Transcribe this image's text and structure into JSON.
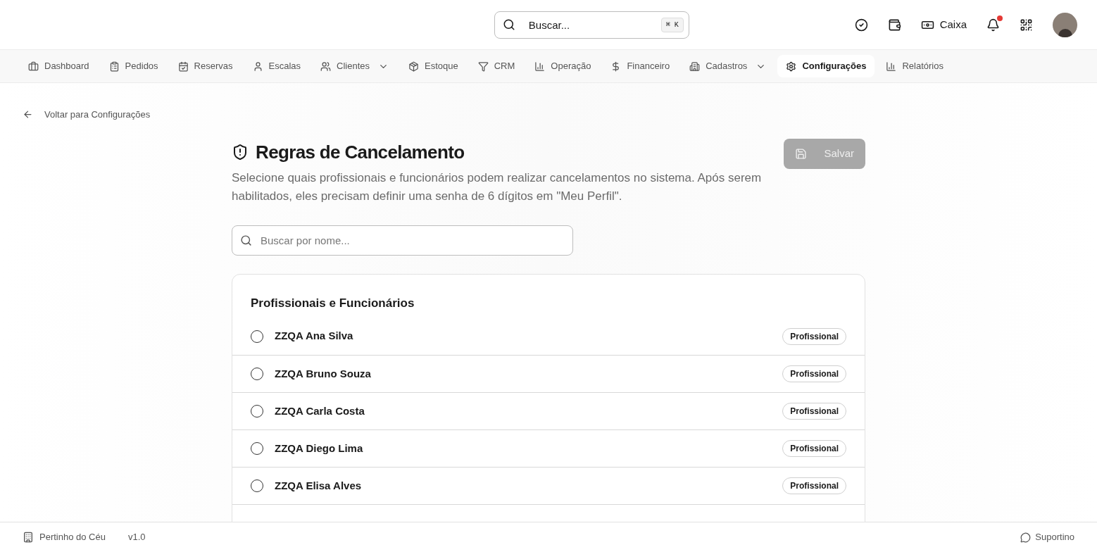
{
  "header": {
    "search": {
      "placeholder": "Buscar...",
      "shortcut": "⌘ K"
    },
    "cash_label": "Caixa",
    "notification": true
  },
  "nav": [
    {
      "label": "Dashboard",
      "dropdown": false,
      "selected": false
    },
    {
      "label": "Pedidos",
      "dropdown": false,
      "selected": false
    },
    {
      "label": "Reservas",
      "dropdown": false,
      "selected": false
    },
    {
      "label": "Escalas",
      "dropdown": false,
      "selected": false
    },
    {
      "label": "Clientes",
      "dropdown": true,
      "selected": false
    },
    {
      "label": "Estoque",
      "dropdown": false,
      "selected": false
    },
    {
      "label": "CRM",
      "dropdown": false,
      "selected": false
    },
    {
      "label": "Operação",
      "dropdown": false,
      "selected": false
    },
    {
      "label": "Financeiro",
      "dropdown": false,
      "selected": false
    },
    {
      "label": "Cadastros",
      "dropdown": true,
      "selected": false
    },
    {
      "label": "Configurações",
      "dropdown": false,
      "selected": true
    },
    {
      "label": "Relatórios",
      "dropdown": false,
      "selected": false
    }
  ],
  "back_link": "Voltar para Configurações",
  "page": {
    "title": "Regras de Cancelamento",
    "description": "Selecione quais profissionais e funcionários podem realizar cancelamentos no sistema. Após serem habilitados, eles precisam definir uma senha de 6 dígitos em \"Meu Perfil\".",
    "save_button": {
      "label": "Salvar",
      "disabled": true
    },
    "search_placeholder": "Buscar por nome..."
  },
  "list": {
    "title": "Profissionais e Funcionários",
    "rows": [
      {
        "name": "ZZQA Ana Silva",
        "role": "Profissional",
        "checked": false
      },
      {
        "name": "ZZQA Bruno Souza",
        "role": "Profissional",
        "checked": false
      },
      {
        "name": "ZZQA Carla Costa",
        "role": "Profissional",
        "checked": false
      },
      {
        "name": "ZZQA Diego Lima",
        "role": "Profissional",
        "checked": false
      },
      {
        "name": "ZZQA Elisa Alves",
        "role": "Profissional",
        "checked": false
      }
    ]
  },
  "footer": {
    "company": "Pertinho do Céu",
    "version": "v1.0",
    "support": "Suportino"
  }
}
